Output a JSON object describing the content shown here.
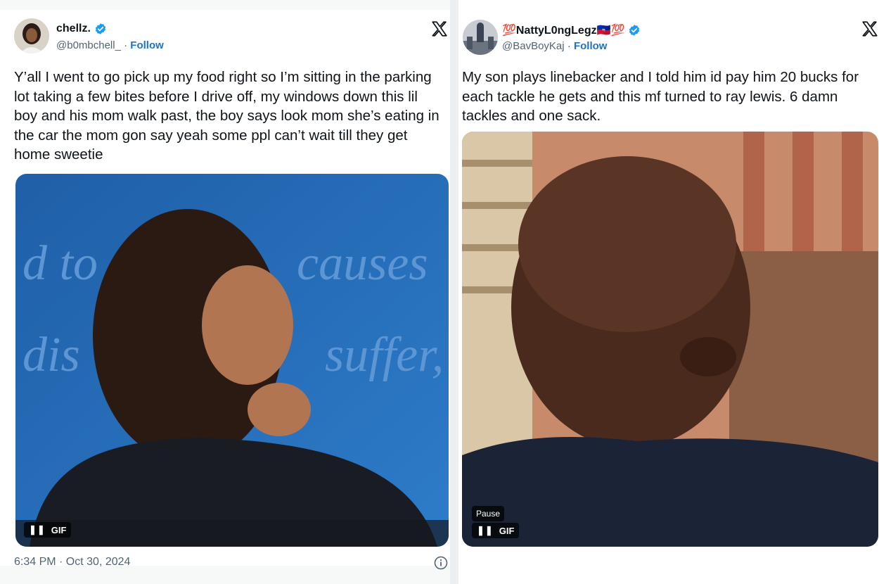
{
  "left_tweet": {
    "author": {
      "name": "chellz.",
      "handle": "@b0mbchell_",
      "follow_label": "Follow",
      "verified": true,
      "avatar_icon": "profile-photo"
    },
    "text": "Y’all I went to go pick up my food right so I’m sitting in the parking lot taking a few bites before I drive off, my windows down this lil boy and his mom walk past, the boy says look mom she’s eating in the car the mom gon say yeah some ppl can’t wait till they get home sweetie",
    "media": {
      "type": "gif",
      "badge_label": "GIF",
      "background_words": [
        "d to",
        "causes",
        "dis",
        "suffer,"
      ]
    },
    "timestamp": "6:34 PM · Oct 30, 2024",
    "platform_icon": "x-logo-icon"
  },
  "right_tweet": {
    "author": {
      "name": "💯NattyL0ngLegz🇭🇹💯",
      "handle": "@BavBoyKaj",
      "follow_label": "Follow",
      "verified": true,
      "avatar_icon": "profile-photo"
    },
    "text": "My son plays linebacker and I told him id pay him 20 bucks for each tackle he gets and this mf turned to ray lewis. 6 damn tackles and one sack.",
    "media": {
      "type": "gif",
      "badge_label": "GIF",
      "tooltip": "Pause"
    },
    "platform_icon": "x-logo-icon"
  },
  "colors": {
    "verified": "#1d9bf0",
    "follow": "#1d74c6",
    "secondary_text": "#536471",
    "primary_text": "#0f1419"
  }
}
